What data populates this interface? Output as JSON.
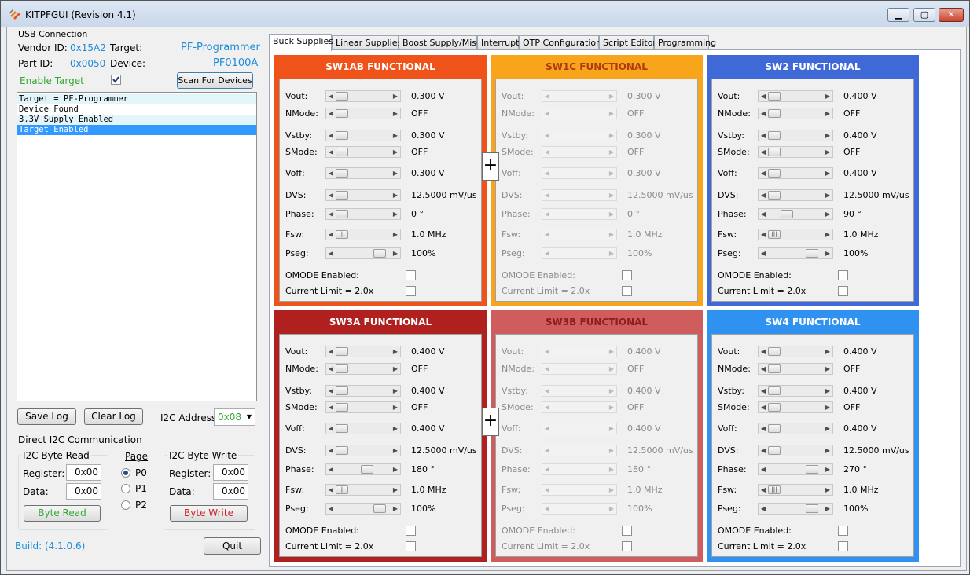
{
  "window": {
    "title": "KITPFGUI (Revision 4.1)",
    "min": "▁",
    "max": "▢",
    "close": "✕"
  },
  "usb": {
    "group_title": "USB Connection",
    "vendor_label": "Vendor ID:",
    "vendor": "0x15A2",
    "target_label": "Target:",
    "target": "PF-Programmer",
    "part_label": "Part ID:",
    "part": "0x0050",
    "device_label": "Device:",
    "device": "PF0100A",
    "enable_label": "Enable Target",
    "enable_checked": true,
    "scan_button": "Scan For Devices"
  },
  "log": [
    "Target = PF-Programmer",
    "Device Found",
    "3.3V Supply Enabled",
    "Target Enabled"
  ],
  "save_log": "Save Log",
  "clear_log": "Clear Log",
  "i2c_addr_label": "I2C Address:",
  "i2c_addr": "0x08",
  "direct": {
    "title": "Direct I2C Communication",
    "read": {
      "title": "I2C Byte Read",
      "reg_label": "Register:",
      "reg": "0x00",
      "data_label": "Data:",
      "data": "0x00",
      "button": "Byte Read"
    },
    "page": {
      "title": "Page",
      "options": [
        "P0",
        "P1",
        "P2"
      ],
      "selected": "P0"
    },
    "write": {
      "title": "I2C Byte Write",
      "reg_label": "Register:",
      "reg": "0x00",
      "data_label": "Data:",
      "data": "0x00",
      "button": "Byte Write"
    }
  },
  "build": "Build: (4.1.0.6)",
  "quit": "Quit",
  "tabs": [
    "Buck Supplies",
    "Linear Supplies",
    "Boost Supply/Misc",
    "Interrupts",
    "OTP Configuration",
    "Script Editor",
    "Programming"
  ],
  "active_tab": "Buck Supplies",
  "labels": {
    "vout": "Vout:",
    "nmode": "NMode:",
    "vstby": "Vstby:",
    "smode": "SMode:",
    "voff": "Voff:",
    "dvs": "DVS:",
    "phase": "Phase:",
    "fsw": "Fsw:",
    "pseg": "Pseg:",
    "omode": "OMODE Enabled:",
    "ilim": "Current Limit = 2.0x"
  },
  "plus": "+",
  "colors": {
    "sw1ab": "#f0531a",
    "sw1c": "#f8a51c",
    "sw2": "#4069d8",
    "sw3a": "#b0201f",
    "sw3b": "#d05d5d",
    "sw4": "#2f92f0"
  },
  "panels": [
    {
      "id": "sw1ab",
      "title": "SW1AB FUNCTIONAL",
      "enabled": true,
      "vout": "0.300 V",
      "nmode": "OFF",
      "vstby": "0.300 V",
      "smode": "OFF",
      "voff": "0.300 V",
      "dvs": "12.5000 mV/us",
      "phase": "0 °",
      "fsw": "1.0 MHz",
      "pseg": "100%"
    },
    {
      "id": "sw1c",
      "title": "SW1C FUNCTIONAL",
      "enabled": false,
      "vout": "0.300 V",
      "nmode": "OFF",
      "vstby": "0.300 V",
      "smode": "OFF",
      "voff": "0.300 V",
      "dvs": "12.5000 mV/us",
      "phase": "0 °",
      "fsw": "1.0 MHz",
      "pseg": "100%"
    },
    {
      "id": "sw2",
      "title": "SW2 FUNCTIONAL",
      "enabled": true,
      "vout": "0.400 V",
      "nmode": "OFF",
      "vstby": "0.400 V",
      "smode": "OFF",
      "voff": "0.400 V",
      "dvs": "12.5000 mV/us",
      "phase": "90 °",
      "fsw": "1.0 MHz",
      "pseg": "100%"
    },
    {
      "id": "sw3a",
      "title": "SW3A FUNCTIONAL",
      "enabled": true,
      "vout": "0.400 V",
      "nmode": "OFF",
      "vstby": "0.400 V",
      "smode": "OFF",
      "voff": "0.400 V",
      "dvs": "12.5000 mV/us",
      "phase": "180 °",
      "fsw": "1.0 MHz",
      "pseg": "100%"
    },
    {
      "id": "sw3b",
      "title": "SW3B FUNCTIONAL",
      "enabled": false,
      "vout": "0.400 V",
      "nmode": "OFF",
      "vstby": "0.400 V",
      "smode": "OFF",
      "voff": "0.400 V",
      "dvs": "12.5000 mV/us",
      "phase": "180 °",
      "fsw": "1.0 MHz",
      "pseg": "100%"
    },
    {
      "id": "sw4",
      "title": "SW4 FUNCTIONAL",
      "enabled": true,
      "vout": "0.400 V",
      "nmode": "OFF",
      "vstby": "0.400 V",
      "smode": "OFF",
      "voff": "0.400 V",
      "dvs": "12.5000 mV/us",
      "phase": "270 °",
      "fsw": "1.0 MHz",
      "pseg": "100%"
    }
  ]
}
